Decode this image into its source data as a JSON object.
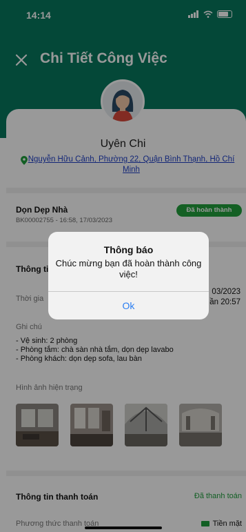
{
  "status_bar": {
    "time": "14:14"
  },
  "header": {
    "title": "Chi Tiết Công Việc"
  },
  "customer": {
    "name": "Uyên Chi",
    "address": "Nguyễn Hữu Cảnh, Phường 22, Quận Bình Thạnh, Hồ Chí Minh"
  },
  "job": {
    "title": "Dọn Dẹp Nhà",
    "code": "BK00002755 - 16:58, 17/03/2023",
    "status_badge": "Đã hoàn thành"
  },
  "info": {
    "section_title": "Thông ti",
    "time_label": "Thời gia",
    "time_date": "03/2023",
    "time_hour": "ần 20:57",
    "note_label": "Ghi chú",
    "notes": [
      "- Vệ sinh: 2 phòng",
      "- Phòng tắm: chà sàn nhà tắm, dọn dẹp lavabo",
      "- Phòng khách: dọn dẹp sofa, lau bàn"
    ],
    "images_label": "Hình ảnh hiện trạng"
  },
  "payment": {
    "title": "Thông tin thanh toán",
    "status": "Đã thanh toán",
    "method_label": "Phương thức thanh toán",
    "method_value": "Tiền mặt"
  },
  "dialog": {
    "title": "Thông báo",
    "message": "Chúc mừng bạn đã hoàn thành công việc!",
    "ok_label": "Ok"
  },
  "colors": {
    "header": "#07795e",
    "badge": "#22a03d",
    "link": "#1e3fc7",
    "dialog_button": "#2a7ef2"
  },
  "icons": [
    "close-icon",
    "map-pin-icon",
    "cash-icon",
    "signal-icon",
    "wifi-icon",
    "battery-icon"
  ]
}
